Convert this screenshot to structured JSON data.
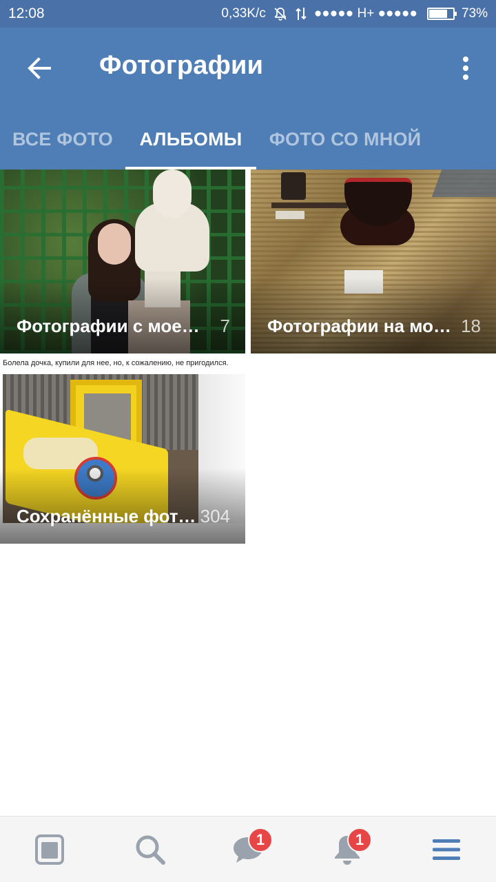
{
  "status_bar": {
    "time": "12:08",
    "net_speed": "0,33K/c",
    "signal_text": "●●●●● H+ ●●●●●",
    "battery": "73%",
    "battery_level": 0.73,
    "icons": [
      "silent-bell-icon",
      "data-arrows-icon",
      "battery-icon"
    ]
  },
  "app_bar": {
    "title": "Фотографии",
    "back_icon": "arrow-left-icon",
    "more_icon": "more-vertical-icon"
  },
  "tabs": [
    {
      "label": "ВСЕ ФОТО",
      "active": false
    },
    {
      "label": "АЛЬБОМЫ",
      "active": true
    },
    {
      "label": "ФОТО СО МНОЙ",
      "active": false
    }
  ],
  "albums": [
    {
      "title": "Фотографии с моей страницы",
      "count": "7"
    },
    {
      "title": "Фотографии на моей стене",
      "count": "18"
    },
    {
      "title": "Сохранённые фотографии",
      "count": "304",
      "image_caption": "Болела дочка, купили для нее, но, к сожалению, не пригодился."
    }
  ],
  "bottom_nav": {
    "items": [
      {
        "icon": "news-icon",
        "badge": ""
      },
      {
        "icon": "search-icon",
        "badge": ""
      },
      {
        "icon": "messages-icon",
        "badge": "1"
      },
      {
        "icon": "notifications-bell-icon",
        "badge": "1"
      },
      {
        "icon": "menu-icon",
        "badge": ""
      }
    ]
  },
  "colors": {
    "status_bar": "#4a72a8",
    "app_bar": "#4f7eb7",
    "badge": "#e64646",
    "nav_icon": "#9aa3ad",
    "menu_icon_active": "#4f7eb7"
  }
}
